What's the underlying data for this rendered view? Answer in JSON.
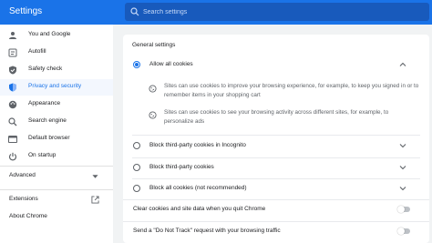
{
  "header": {
    "title": "Settings",
    "search_placeholder": "Search settings"
  },
  "sidebar": {
    "items": [
      {
        "label": "You and Google",
        "icon": "person-icon"
      },
      {
        "label": "Autofill",
        "icon": "autofill-icon"
      },
      {
        "label": "Safety check",
        "icon": "shield-check-icon"
      },
      {
        "label": "Privacy and security",
        "icon": "shield-icon",
        "active": true
      },
      {
        "label": "Appearance",
        "icon": "palette-icon"
      },
      {
        "label": "Search engine",
        "icon": "search-icon"
      },
      {
        "label": "Default browser",
        "icon": "browser-icon"
      },
      {
        "label": "On startup",
        "icon": "power-icon"
      }
    ],
    "advanced_label": "Advanced",
    "extensions_label": "Extensions",
    "about_label": "About Chrome"
  },
  "main": {
    "section_title": "General settings",
    "options": [
      {
        "label": "Allow all cookies",
        "checked": true,
        "expanded": true
      },
      {
        "label": "Block third-party cookies in Incognito",
        "checked": false
      },
      {
        "label": "Block third-party cookies",
        "checked": false
      },
      {
        "label": "Block all cookies (not recommended)",
        "checked": false
      }
    ],
    "details": [
      "Sites can use cookies to improve your browsing experience, for example, to keep you signed in or to remember items in your shopping cart",
      "Sites can use cookies to see your browsing activity across different sites, for example, to personalize ads"
    ],
    "toggles": [
      {
        "label": "Clear cookies and site data when you quit Chrome",
        "on": false
      },
      {
        "label": "Send a \"Do Not Track\" request with your browsing traffic",
        "on": false
      }
    ]
  },
  "colors": {
    "accent": "#1a73e8",
    "header_bg": "#1a73e8",
    "search_bg": "#185abc",
    "page_bg": "#f1f3f4"
  }
}
